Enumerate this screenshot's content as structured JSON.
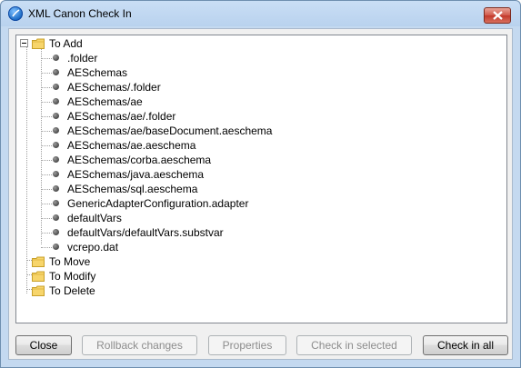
{
  "window": {
    "title": "XML Canon Check In"
  },
  "tree": {
    "groups": [
      {
        "label": "To Add",
        "items": [
          ".folder",
          "AESchemas",
          "AESchemas/.folder",
          "AESchemas/ae",
          "AESchemas/ae/.folder",
          "AESchemas/ae/baseDocument.aeschema",
          "AESchemas/ae.aeschema",
          "AESchemas/corba.aeschema",
          "AESchemas/java.aeschema",
          "AESchemas/sql.aeschema",
          "GenericAdapterConfiguration.adapter",
          "defaultVars",
          "defaultVars/defaultVars.substvar",
          "vcrepo.dat"
        ]
      },
      {
        "label": "To Move",
        "items": []
      },
      {
        "label": "To Modify",
        "items": []
      },
      {
        "label": "To Delete",
        "items": []
      }
    ]
  },
  "buttons": {
    "close": {
      "label": "Close",
      "enabled": true
    },
    "rollback": {
      "label": "Rollback changes",
      "enabled": false
    },
    "properties": {
      "label": "Properties",
      "enabled": false
    },
    "check_in_selected": {
      "label": "Check in selected",
      "enabled": false
    },
    "check_in_all": {
      "label": "Check in all",
      "enabled": true
    }
  },
  "icons": {
    "app": "xml-canon-app-icon",
    "close": "close-icon",
    "group": "folder-icon",
    "item": "file-bullet-icon",
    "expander": "collapse-minus-icon"
  }
}
